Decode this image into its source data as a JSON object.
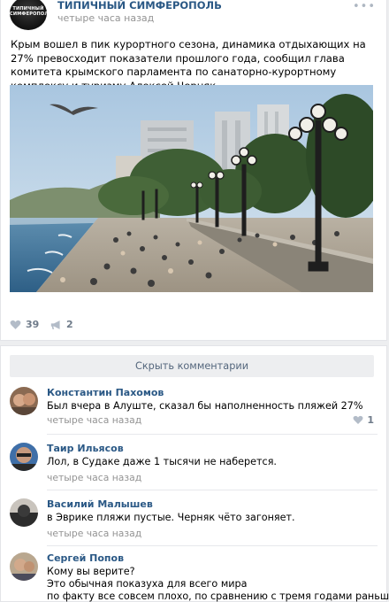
{
  "post": {
    "group_name": "ТИПИЧНЫЙ СИМФЕРОПОЛЬ",
    "avatar_caption": "ТИПИЧНЫЙ СИМФЕРОПОЛЬ",
    "time": "четыре часа назад",
    "text": "Крым вошел в пик курортного сезона, динамика отдыхающих на 27% превосходит показатели прошлого года, сообщил глава комитета крымского парламента по санаторно-курортному комплексу и туризму Алексей Черняк.",
    "photo_icon": "beach-promenade-photo",
    "likes": "39",
    "shares": "2"
  },
  "comments_block": {
    "hide_label": "Скрыть комментарии",
    "items": [
      {
        "author": "Константин Пахомов",
        "text": "Был вчера в Алуште, сказал бы наполненность пляжей 27%",
        "time": "четыре часа назад",
        "likes": "1"
      },
      {
        "author": "Таир Ильясов",
        "text": "Лол, в Судаке даже 1 тысячи не наберется.",
        "time": "четыре часа назад"
      },
      {
        "author": "Василий Малышев",
        "text": "в Эврике пляжи пустые. Черняк чёто загоняет.",
        "time": "четыре часа назад"
      },
      {
        "author": "Сергей Попов",
        "text_lines": [
          "Кому вы верите?",
          "Это обычная показуха для всего мира",
          "по факту все совсем плохо, по сравнению с тремя годами раньше"
        ]
      }
    ]
  },
  "colors": {
    "link": "#2a5885",
    "meta": "#939393",
    "action": "#6f7b8a",
    "background": "#edeef0"
  }
}
